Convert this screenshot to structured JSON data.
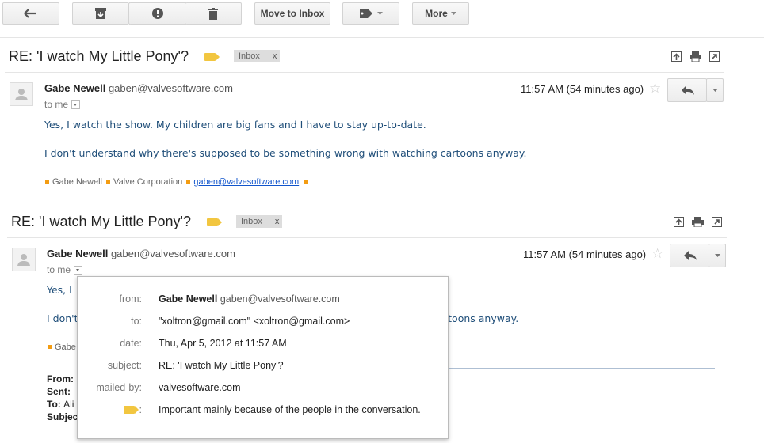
{
  "toolbar": {
    "back_icon": "back-arrow-icon",
    "archive_icon": "archive-icon",
    "spam_icon": "report-spam-icon",
    "delete_icon": "trash-icon",
    "move_to_inbox_label": "Move to Inbox",
    "labels_icon": "tag-icon",
    "more_label": "More"
  },
  "messages": [
    {
      "subject": "RE: 'I watch My Little Pony'?",
      "label": "Inbox",
      "label_close": "x",
      "sender_name": "Gabe Newell",
      "sender_email": "gaben@valvesoftware.com",
      "to": "to me",
      "time": "11:57 AM (54 minutes ago)",
      "body": [
        "Yes, I watch the show. My children are big fans and I have to stay up-to-date.",
        "I don't understand why there's supposed to be something wrong with watching cartoons anyway."
      ],
      "signature": [
        "Gabe Newell",
        "Valve Corporation",
        "gaben@valvesoftware.com"
      ]
    },
    {
      "subject": "RE: 'I watch My Little Pony'?",
      "label": "Inbox",
      "label_close": "x",
      "sender_name": "Gabe Newell",
      "sender_email": "gaben@valvesoftware.com",
      "to": "to me",
      "time": "11:57 AM (54 minutes ago)",
      "body_visible": [
        "Yes, I",
        "I don't",
        "rtoons anyway."
      ],
      "signature_visible": "Gabe",
      "quoted_header": {
        "from": "From:",
        "sent": "Sent:",
        "to": "To:",
        "to_partial": "Ali",
        "subject": "Subjec"
      }
    }
  ],
  "details_popup": {
    "rows": [
      {
        "key": "from:",
        "name": "Gabe Newell",
        "value": "gaben@valvesoftware.com"
      },
      {
        "key": "to:",
        "value": "\"xoltron@gmail.com\" <xoltron@gmail.com>"
      },
      {
        "key": "date:",
        "value": "Thu, Apr 5, 2012 at 11:57 AM"
      },
      {
        "key": "subject:",
        "value": "RE: 'I watch My Little Pony'?"
      },
      {
        "key": "mailed-by:",
        "value": "valvesoftware.com"
      },
      {
        "key": ":",
        "value": "Important mainly because of the people in the conversation."
      }
    ]
  },
  "colors": {
    "important_marker": "#f2c640",
    "body_text": "#1f4e79",
    "link": "#1155cc",
    "signature_square": "#f39c12"
  }
}
